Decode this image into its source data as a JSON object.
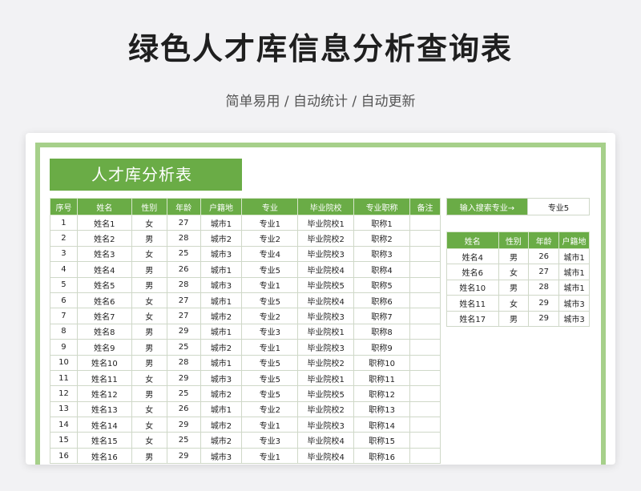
{
  "header": {
    "title": "绿色人才库信息分析查询表",
    "subtitle": "简单易用 / 自动统计 / 自动更新"
  },
  "sheet": {
    "title": "人才库分析表",
    "columns": [
      "序号",
      "姓名",
      "性别",
      "年龄",
      "户籍地",
      "专业",
      "毕业院校",
      "专业职称",
      "备注"
    ],
    "rows": [
      [
        "1",
        "姓名1",
        "女",
        "27",
        "城市1",
        "专业1",
        "毕业院校1",
        "职称1",
        ""
      ],
      [
        "2",
        "姓名2",
        "男",
        "28",
        "城市2",
        "专业2",
        "毕业院校2",
        "职称2",
        ""
      ],
      [
        "3",
        "姓名3",
        "女",
        "25",
        "城市3",
        "专业4",
        "毕业院校3",
        "职称3",
        ""
      ],
      [
        "4",
        "姓名4",
        "男",
        "26",
        "城市1",
        "专业5",
        "毕业院校4",
        "职称4",
        ""
      ],
      [
        "5",
        "姓名5",
        "男",
        "28",
        "城市3",
        "专业1",
        "毕业院校5",
        "职称5",
        ""
      ],
      [
        "6",
        "姓名6",
        "女",
        "27",
        "城市1",
        "专业5",
        "毕业院校4",
        "职称6",
        ""
      ],
      [
        "7",
        "姓名7",
        "女",
        "27",
        "城市2",
        "专业2",
        "毕业院校3",
        "职称7",
        ""
      ],
      [
        "8",
        "姓名8",
        "男",
        "29",
        "城市1",
        "专业3",
        "毕业院校1",
        "职称8",
        ""
      ],
      [
        "9",
        "姓名9",
        "男",
        "25",
        "城市2",
        "专业1",
        "毕业院校3",
        "职称9",
        ""
      ],
      [
        "10",
        "姓名10",
        "男",
        "28",
        "城市1",
        "专业5",
        "毕业院校2",
        "职称10",
        ""
      ],
      [
        "11",
        "姓名11",
        "女",
        "29",
        "城市3",
        "专业5",
        "毕业院校1",
        "职称11",
        ""
      ],
      [
        "12",
        "姓名12",
        "男",
        "25",
        "城市2",
        "专业5",
        "毕业院校5",
        "职称12",
        ""
      ],
      [
        "13",
        "姓名13",
        "女",
        "26",
        "城市1",
        "专业2",
        "毕业院校2",
        "职称13",
        ""
      ],
      [
        "14",
        "姓名14",
        "女",
        "29",
        "城市2",
        "专业1",
        "毕业院校3",
        "职称14",
        ""
      ],
      [
        "15",
        "姓名15",
        "女",
        "25",
        "城市2",
        "专业3",
        "毕业院校4",
        "职称15",
        ""
      ],
      [
        "16",
        "姓名16",
        "男",
        "29",
        "城市3",
        "专业1",
        "毕业院校4",
        "职称16",
        ""
      ]
    ]
  },
  "search": {
    "label": "输入搜索专业→",
    "value": "专业5"
  },
  "results": {
    "columns": [
      "姓名",
      "性别",
      "年龄",
      "户籍地"
    ],
    "rows": [
      [
        "姓名4",
        "男",
        "26",
        "城市1"
      ],
      [
        "姓名6",
        "女",
        "27",
        "城市1"
      ],
      [
        "姓名10",
        "男",
        "28",
        "城市1"
      ],
      [
        "姓名11",
        "女",
        "29",
        "城市3"
      ],
      [
        "姓名17",
        "男",
        "29",
        "城市3"
      ]
    ]
  },
  "colors": {
    "accent": "#6aac46",
    "frame": "#a6d08a"
  }
}
